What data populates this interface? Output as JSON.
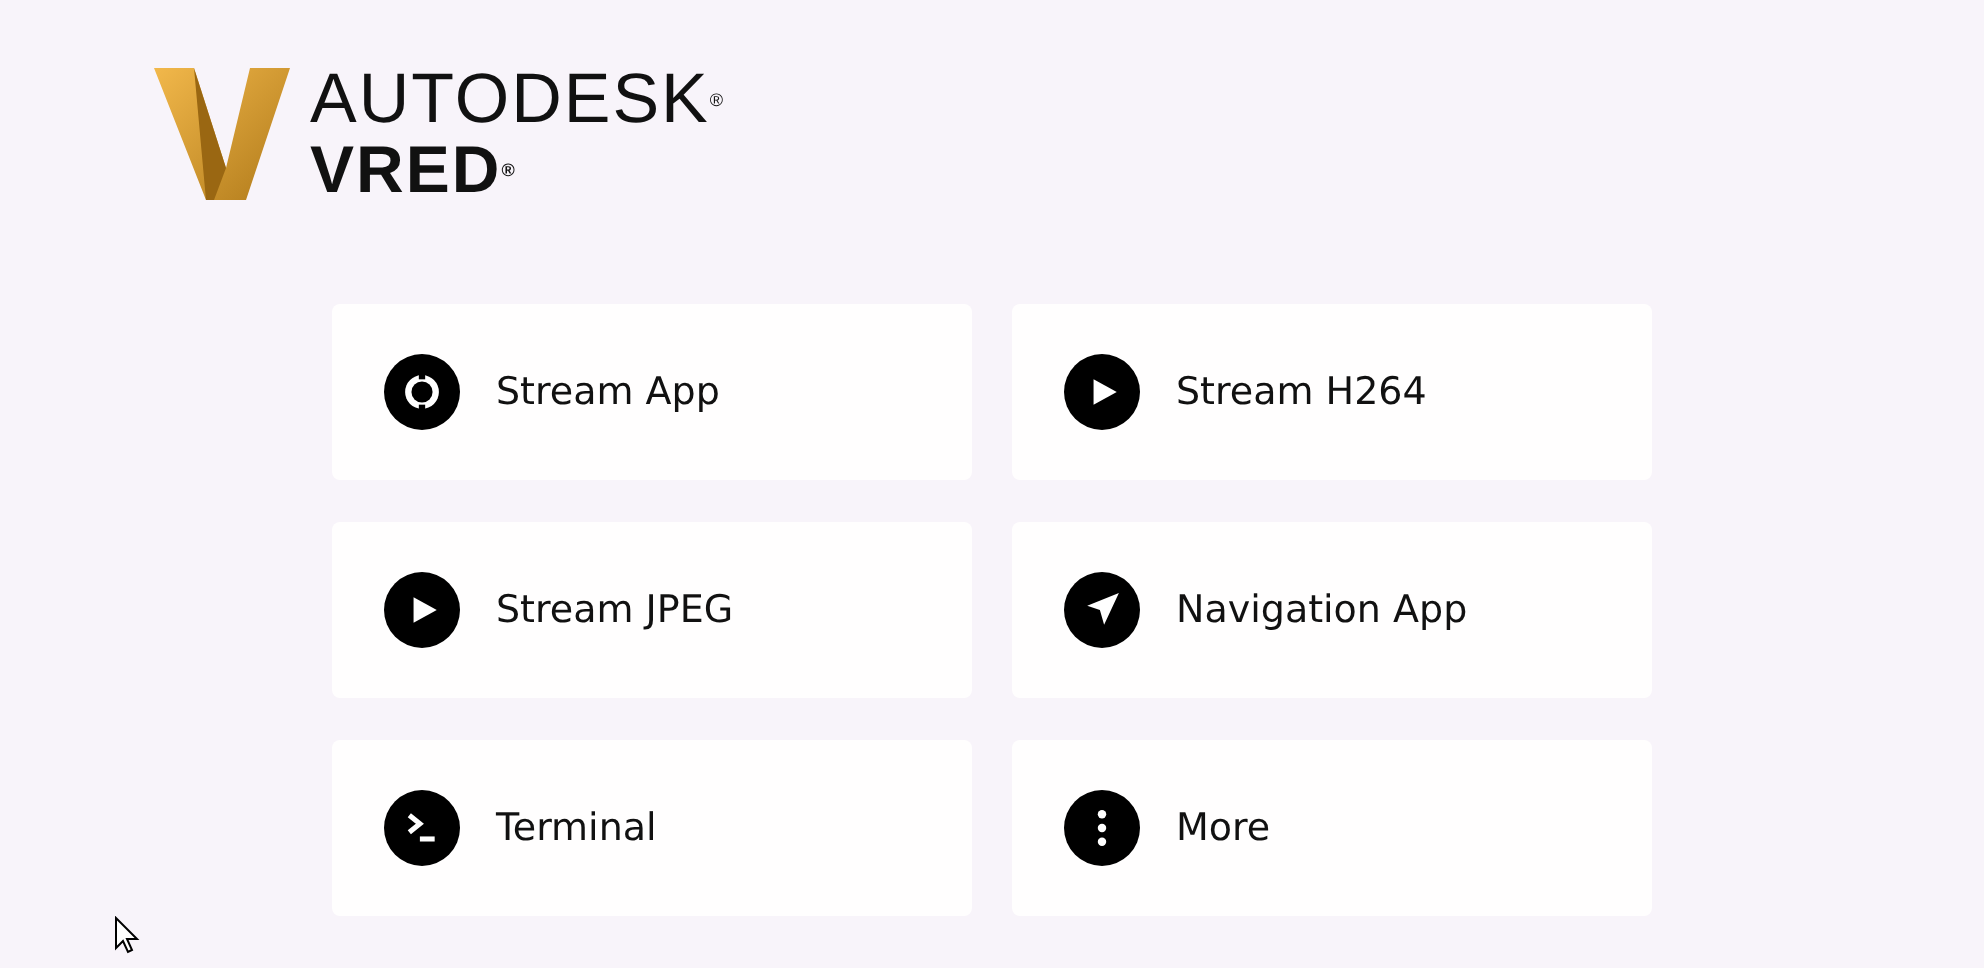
{
  "logo": {
    "brand": "AUTODESK",
    "registered_mark": "®",
    "product": "VRED",
    "product_mark": "®"
  },
  "tiles": [
    {
      "label": "Stream App",
      "kind": "ring"
    },
    {
      "label": "Stream H264",
      "kind": "play"
    },
    {
      "label": "Stream JPEG",
      "kind": "play"
    },
    {
      "label": "Navigation App",
      "kind": "navigate"
    },
    {
      "label": "Terminal",
      "kind": "terminal"
    },
    {
      "label": "More",
      "kind": "more"
    }
  ]
}
